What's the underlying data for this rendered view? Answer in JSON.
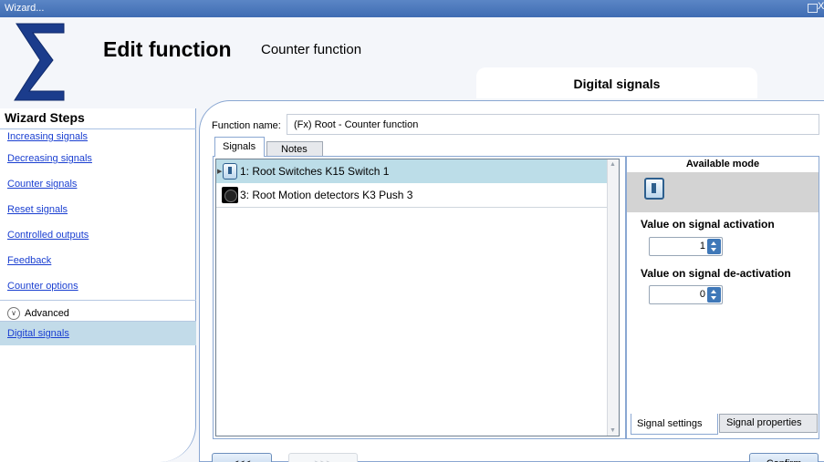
{
  "window": {
    "title": "Wizard...",
    "maximize_icon": "maximize-icon",
    "close_glyph": "X"
  },
  "header": {
    "logo_icon": "sigma-logo-icon",
    "title": "Edit function",
    "subtitle": "Counter function"
  },
  "top_tab": {
    "label": "Digital signals"
  },
  "wizard": {
    "title": "Wizard Steps",
    "steps": [
      {
        "label": "Increasing signals"
      },
      {
        "label": "Decreasing signals"
      },
      {
        "label": "Counter signals"
      },
      {
        "label": "Reset signals"
      },
      {
        "label": "Controlled outputs"
      },
      {
        "label": "Feedback"
      },
      {
        "label": "Counter options"
      }
    ],
    "advanced_label": "Advanced",
    "advanced_steps": [
      {
        "label": "Digital signals",
        "selected": true
      }
    ]
  },
  "function_name": {
    "label": "Function name:",
    "value": "(Fx) Root - Counter function"
  },
  "tabs": [
    {
      "label": "Signals",
      "active": true
    },
    {
      "label": "Notes",
      "active": false
    }
  ],
  "signals": [
    {
      "label": "1: Root Switches K15 Switch 1",
      "icon": "switch-icon",
      "selected": true
    },
    {
      "label": "3: Root Motion detectors K3 Push 3",
      "icon": "motion-detector-icon",
      "selected": false
    }
  ],
  "settings": {
    "available_mode_title": "Available mode",
    "mode_icon": "switch-mode-icon",
    "activation_label": "Value on signal activation",
    "activation_value": "1",
    "deactivation_label": "Value on signal de-activation",
    "deactivation_value": "0",
    "bottom_tabs": [
      {
        "label": "Signal settings",
        "active": true
      },
      {
        "label": "Signal properties",
        "active": false
      }
    ]
  },
  "footer": {
    "back_label": "<<<",
    "next_label": ">>>",
    "confirm_label": "Confirm"
  },
  "colors": {
    "accent": "#3f6cb3",
    "selection": "#bcdde8",
    "step_selected": "#c2dbe9",
    "link": "#1a3fd1"
  }
}
